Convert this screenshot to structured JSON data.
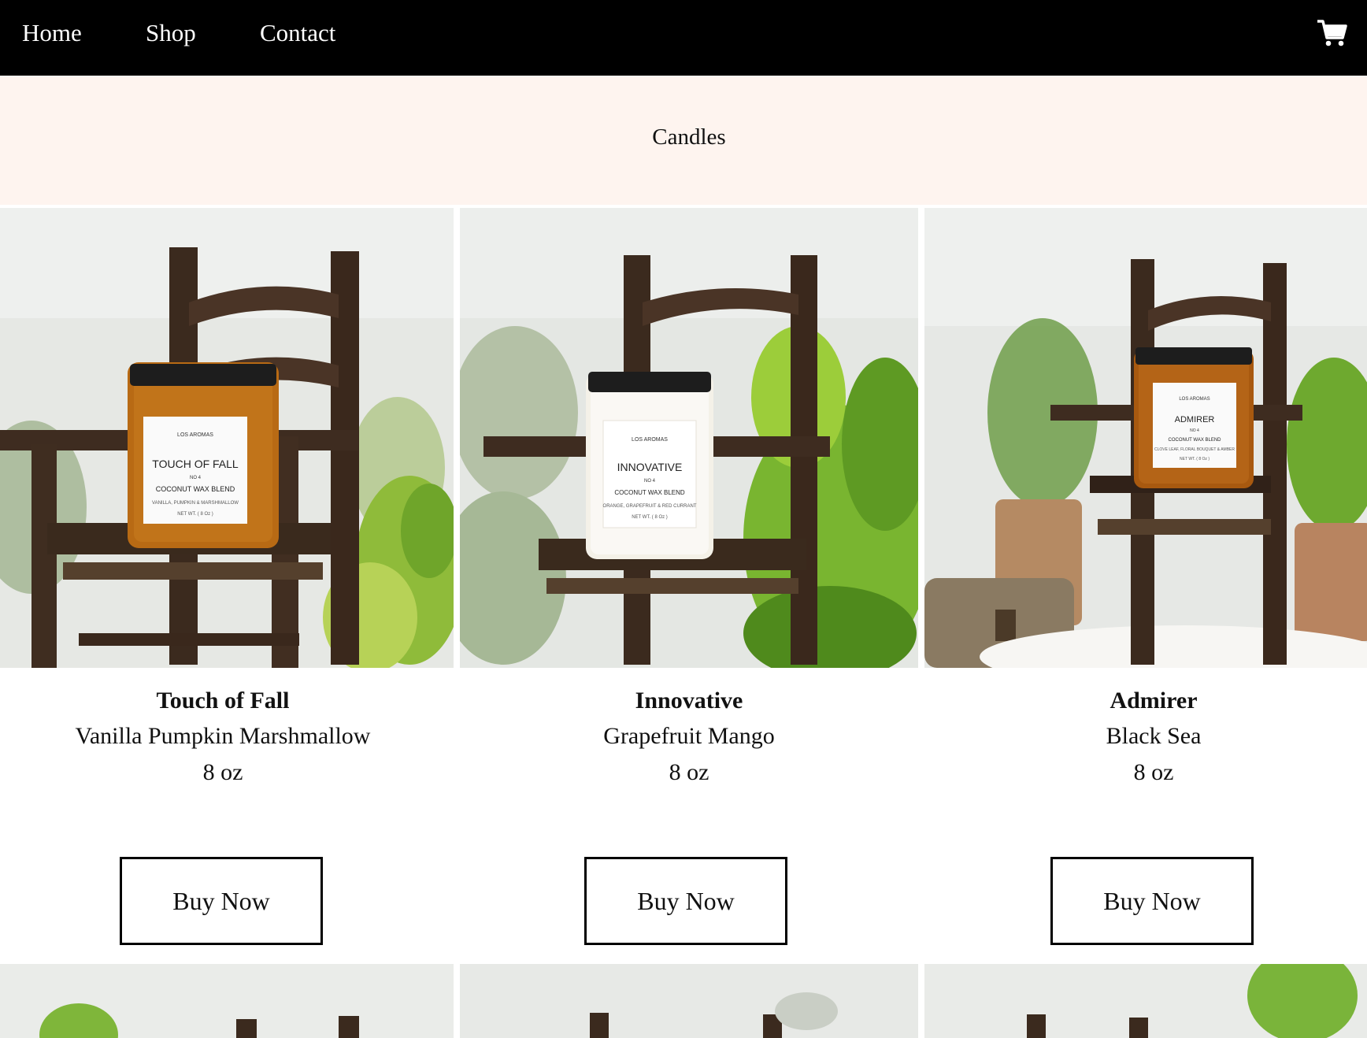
{
  "nav": {
    "items": [
      {
        "label": "Home"
      },
      {
        "label": "Shop"
      },
      {
        "label": "Contact"
      }
    ],
    "cart_icon": "shopping-cart-icon"
  },
  "banner": {
    "title": "Candles"
  },
  "products": [
    {
      "name": "Touch of Fall",
      "scent": "Vanilla Pumpkin Marshmallow",
      "size": "8 oz",
      "button_label": "Buy Now",
      "label": {
        "brand": "LOS AROMAS",
        "title": "TOUCH OF FALL",
        "no": "NO 4",
        "blend": "COCONUT WAX BLEND",
        "notes": "VANILLA, PUMPKIN & MARSHMALLOW",
        "weight": "NET WT. ( 8 Oz )"
      }
    },
    {
      "name": "Innovative",
      "scent": "Grapefruit Mango",
      "size": "8 oz",
      "button_label": "Buy Now",
      "label": {
        "brand": "LOS AROMAS",
        "title": "INNOVATIVE",
        "no": "NO 4",
        "blend": "COCONUT WAX BLEND",
        "notes": "ORANGE, GRAPEFRUIT & RED CURRANT",
        "weight": "NET WT. ( 8 Oz )"
      }
    },
    {
      "name": "Admirer",
      "scent": "Black Sea",
      "size": "8 oz",
      "button_label": "Buy Now",
      "label": {
        "brand": "LOS AROMAS",
        "title": "ADMIRER",
        "no": "NO 4",
        "blend": "COCONUT WAX BLEND",
        "notes": "CLOVE LEAF, FLORAL BOUQUET & AMBER",
        "weight": "NET WT. ( 8 Oz )"
      }
    }
  ],
  "colors": {
    "nav_bg": "#000000",
    "banner_bg": "#fef4ef",
    "amber_jar": "#b86a14",
    "clear_jar": "#f4f1e8",
    "chair_wood": "#3b2a1e",
    "leaf_green": "#6fae2a"
  }
}
